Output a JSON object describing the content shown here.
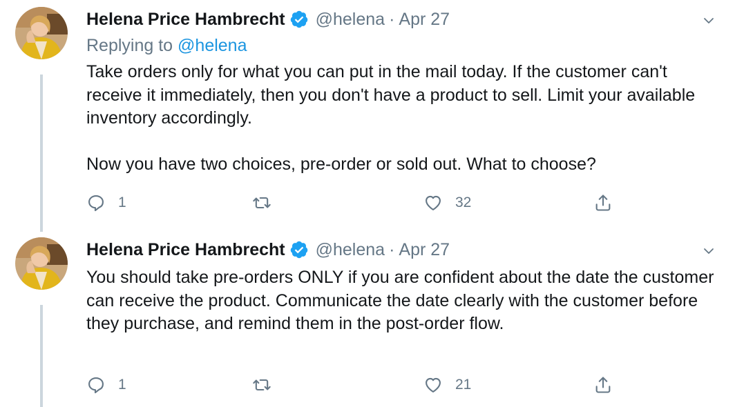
{
  "tweets": [
    {
      "name": "Helena Price Hambrecht",
      "handle": "@helena",
      "separator": "·",
      "date": "Apr 27",
      "replying_prefix": "Replying to ",
      "replying_to": "@helena",
      "paragraphs": [
        "Take orders only for what you can put in the mail today. If the customer can't receive it immediately, then you don't have a product to sell. Limit your available inventory accordingly.",
        "Now you have two choices, pre-order or sold out. What to choose?"
      ],
      "reply_count": "1",
      "retweet_count": "",
      "like_count": "32"
    },
    {
      "name": "Helena Price Hambrecht",
      "handle": "@helena",
      "separator": "·",
      "date": "Apr 27",
      "paragraphs": [
        "You should take pre-orders ONLY if you are confident about the date the customer can receive the product. Communicate the date clearly with the customer before they purchase, and remind them in the post-order flow."
      ],
      "reply_count": "1",
      "retweet_count": "",
      "like_count": "21"
    }
  ],
  "colors": {
    "text": "#14171a",
    "secondary": "#657786",
    "link": "#1b95e0",
    "verified": "#1da1f2",
    "thread_line": "#ccd6dd"
  },
  "icons": [
    "reply-icon",
    "retweet-icon",
    "like-icon",
    "share-icon",
    "verified-badge-icon",
    "chevron-down-icon"
  ]
}
